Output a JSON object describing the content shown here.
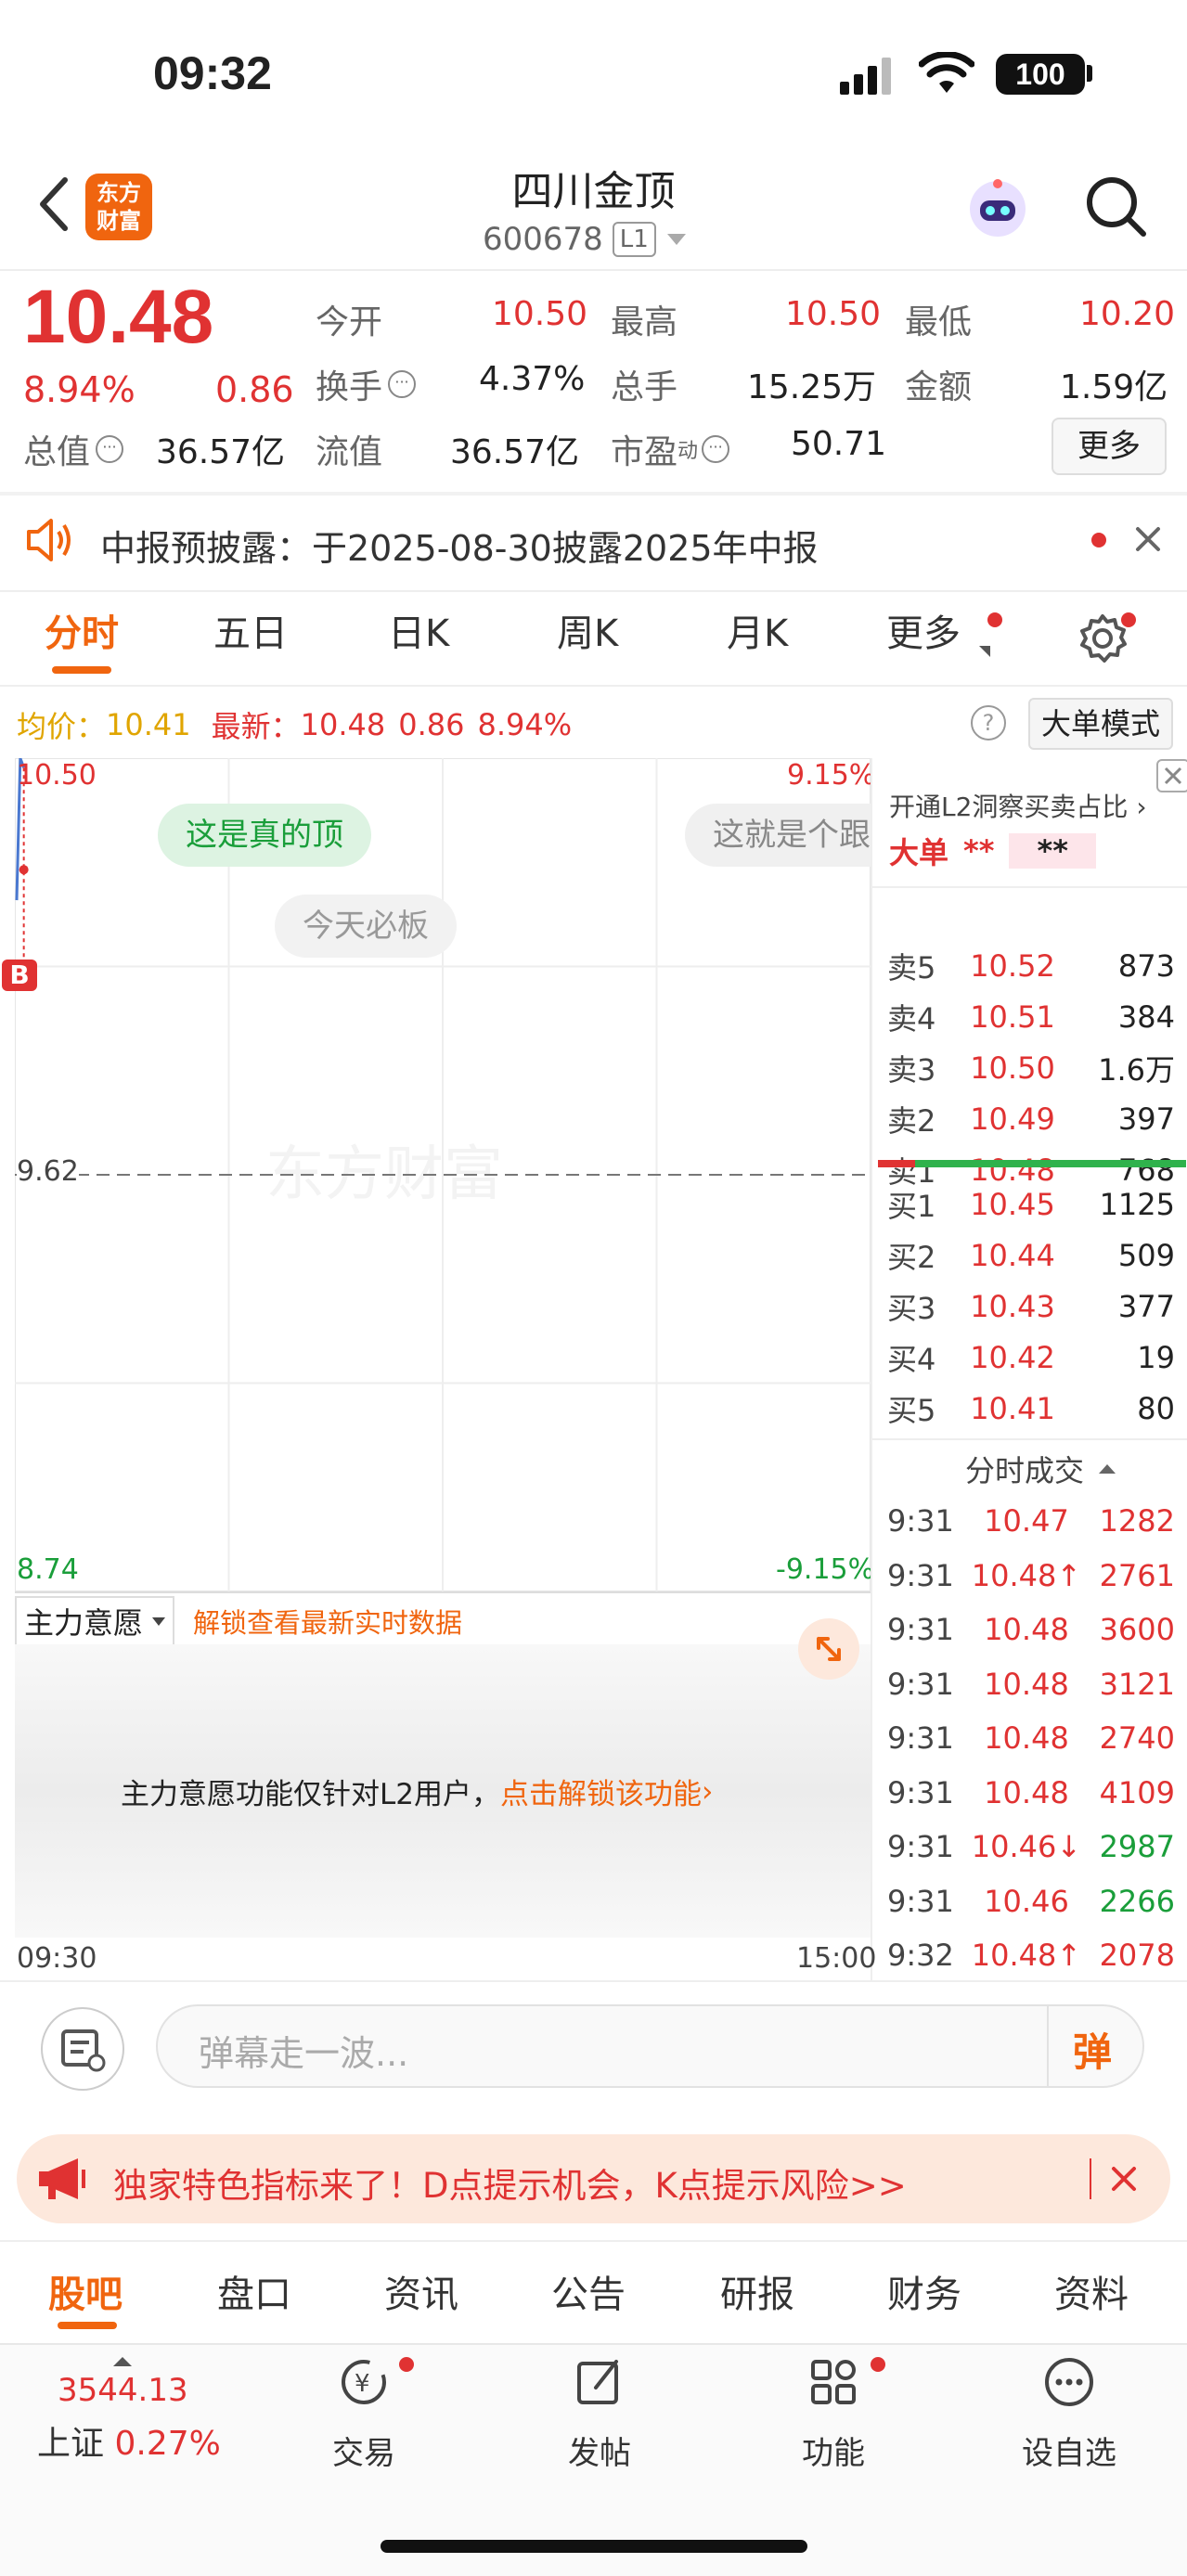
{
  "status": {
    "time": "09:32",
    "battery": "100"
  },
  "header": {
    "title": "四川金顶",
    "code": "600678",
    "level_badge": "L1",
    "logo_text_top": "东方",
    "logo_text_bottom": "财富"
  },
  "quote": {
    "price": "10.48",
    "change_pct": "8.94%",
    "change": "0.86",
    "open_label": "今开",
    "open": "10.50",
    "high_label": "最高",
    "high": "10.50",
    "low_label": "最低",
    "low": "10.20",
    "turnover_label": "换手",
    "turnover": "4.37%",
    "volume_label": "总手",
    "volume": "15.25万",
    "amount_label": "金额",
    "amount": "1.59亿",
    "mktcap_label": "总值",
    "mktcap": "36.57亿",
    "float_label": "流值",
    "float": "36.57亿",
    "pe_label": "市盈",
    "pe_sup": "动",
    "pe": "50.71",
    "more_button": "更多"
  },
  "notice": {
    "text": "中报预披露：于2025-08-30披露2025年中报"
  },
  "tabs": {
    "t1": "分时",
    "t2": "五日",
    "t3": "日K",
    "t4": "周K",
    "t5": "月K",
    "t6": "更多"
  },
  "chart_info": {
    "avg_label": "均价：",
    "avg": "10.41",
    "latest_label": "最新：",
    "latest": "10.48",
    "latest_change": "0.86",
    "latest_pct": "8.94%",
    "mode_button": "大单模式"
  },
  "chart_data": {
    "type": "line",
    "x": [
      "09:30",
      "09:31",
      "09:32"
    ],
    "series": [
      {
        "values": [
          10.2,
          10.5,
          10.48
        ]
      }
    ],
    "ylim": [
      8.74,
      10.5
    ],
    "y_ticks": [
      "10.50",
      "9.62",
      "8.74"
    ],
    "right_ticks": [
      "9.15%",
      "-9.15%"
    ],
    "x_ticks": [
      "09:30",
      "15:00"
    ],
    "prev_close": 9.62,
    "title": "",
    "xlabel": "",
    "ylabel": ""
  },
  "danmaku": {
    "d1": "这是真的顶",
    "d2": "今天必板",
    "d3": "这就是个跟"
  },
  "watermark": "东方财富",
  "buy_marker": "B",
  "orderbook": {
    "promo": "开通L2洞察买卖占比",
    "big_label": "大单",
    "big_mask1": "**",
    "big_mask2": "**",
    "asks": [
      {
        "label": "卖5",
        "price": "10.52",
        "vol": "873"
      },
      {
        "label": "卖4",
        "price": "10.51",
        "vol": "384"
      },
      {
        "label": "卖3",
        "price": "10.50",
        "vol": "1.6万"
      },
      {
        "label": "卖2",
        "price": "10.49",
        "vol": "397"
      },
      {
        "label": "卖1",
        "price": "10.48",
        "vol": "768"
      }
    ],
    "bids": [
      {
        "label": "买1",
        "price": "10.45",
        "vol": "1125"
      },
      {
        "label": "买2",
        "price": "10.44",
        "vol": "509"
      },
      {
        "label": "买3",
        "price": "10.43",
        "vol": "377"
      },
      {
        "label": "买4",
        "price": "10.42",
        "vol": "19"
      },
      {
        "label": "买5",
        "price": "10.41",
        "vol": "80"
      }
    ]
  },
  "trades": {
    "title": "分时成交",
    "rows": [
      {
        "time": "9:31",
        "price": "10.47",
        "vol": "1282",
        "vcolor": "#e03232"
      },
      {
        "time": "9:31",
        "price": "10.48↑",
        "vol": "2761",
        "vcolor": "#e03232"
      },
      {
        "time": "9:31",
        "price": "10.48",
        "vol": "3600",
        "vcolor": "#e03232"
      },
      {
        "time": "9:31",
        "price": "10.48",
        "vol": "3121",
        "vcolor": "#e03232"
      },
      {
        "time": "9:31",
        "price": "10.48",
        "vol": "2740",
        "vcolor": "#e03232"
      },
      {
        "time": "9:31",
        "price": "10.48",
        "vol": "4109",
        "vcolor": "#e03232"
      },
      {
        "time": "9:31",
        "price": "10.46↓",
        "vol": "2987",
        "vcolor": "#1a9e3a"
      },
      {
        "time": "9:31",
        "price": "10.46",
        "vol": "2266",
        "vcolor": "#1a9e3a"
      },
      {
        "time": "9:32",
        "price": "10.48↑",
        "vol": "2078",
        "vcolor": "#e03232"
      }
    ]
  },
  "main_force": {
    "select_label": "主力意愿",
    "unlock_link": "解锁查看最新实时数据",
    "locked_text": "主力意愿功能仅针对L2用户，",
    "locked_link": "点击解锁该功能"
  },
  "comment": {
    "placeholder": "弹幕走一波...",
    "send": "弹"
  },
  "ad": {
    "text": "独家特色指标来了！D点提示机会，K点提示风险>>"
  },
  "bottom_tabs": {
    "b1": "股吧",
    "b2": "盘口",
    "b3": "资讯",
    "b4": "公告",
    "b5": "研报",
    "b6": "财务",
    "b7": "资料"
  },
  "bottom_nav": {
    "index_value": "3544.13",
    "index_name": "上证",
    "index_pct": "0.27%",
    "trade": "交易",
    "post": "发帖",
    "func": "功能",
    "watch": "设自选"
  },
  "colors": {
    "up": "#e03232",
    "down": "#1a9e3a",
    "accent": "#f0650f"
  }
}
